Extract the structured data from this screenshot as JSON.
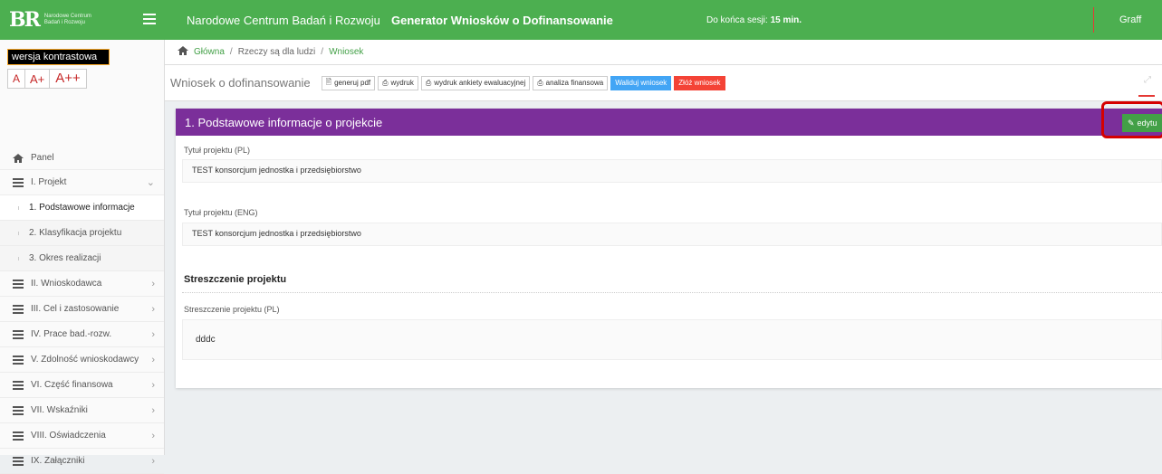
{
  "header": {
    "logo_text": "BR",
    "logo_subtitle": "Narodowe Centrum Badań i Rozwoju",
    "org_name": "Narodowe Centrum Badań i Rozwoju",
    "app_title": "Generator Wniosków o Dofinansowanie",
    "session_label": "Do końca sesji:",
    "session_value": "15 min.",
    "user": "Graff",
    "brand_color": "#4caf50"
  },
  "sidebar": {
    "contrast": "wersja kontrastowa",
    "font_sizes": [
      "A",
      "A+",
      "A++"
    ],
    "items": [
      {
        "label": "Panel",
        "icon": "home-icon"
      },
      {
        "label": "I. Projekt",
        "icon": "list-icon",
        "arrow": "⌄"
      },
      {
        "label": "1. Podstawowe informacje"
      },
      {
        "label": "2. Klasyfikacja projektu"
      },
      {
        "label": "3. Okres realizacji"
      },
      {
        "label": "II. Wnioskodawca",
        "arrow": "›"
      },
      {
        "label": "III. Cel i zastosowanie",
        "arrow": "›"
      },
      {
        "label": "IV. Prace bad.-rozw.",
        "arrow": "›"
      },
      {
        "label": "V. Zdolność wnioskodawcy",
        "arrow": "›"
      },
      {
        "label": "VI. Część finansowa",
        "arrow": "›"
      },
      {
        "label": "VII. Wskaźniki",
        "arrow": "›"
      },
      {
        "label": "VIII. Oświadczenia",
        "arrow": "›"
      },
      {
        "label": "IX. Załączniki",
        "arrow": "›"
      }
    ]
  },
  "breadcrumb": [
    "Główna",
    "Rzeczy są dla ludzi",
    "Wniosek"
  ],
  "toolbar": {
    "title": "Wniosek o dofinansowanie",
    "buttons": [
      "generuj pdf",
      "wydruk",
      "wydruk ankiety ewaluacyjnej",
      "analiza finansowa"
    ],
    "validate": "Waliduj wniosek",
    "submit": "Złóż wniosek"
  },
  "section": {
    "title": "1. Podstawowe informacje o projekcie",
    "edit": "edytu",
    "header_color": "#7b2f9a",
    "fields": [
      {
        "label": "Tytuł projektu (PL)",
        "value": "TEST konsorcjum jednostka i przedsiębiorstwo"
      },
      {
        "label": "Tytuł projektu (ENG)",
        "value": "TEST konsorcjum jednostka i przedsiębiorstwo"
      }
    ],
    "summary_heading": "Streszczenie projektu",
    "summary_label": "Streszczenie projektu (PL)",
    "summary_value": "dddc"
  }
}
